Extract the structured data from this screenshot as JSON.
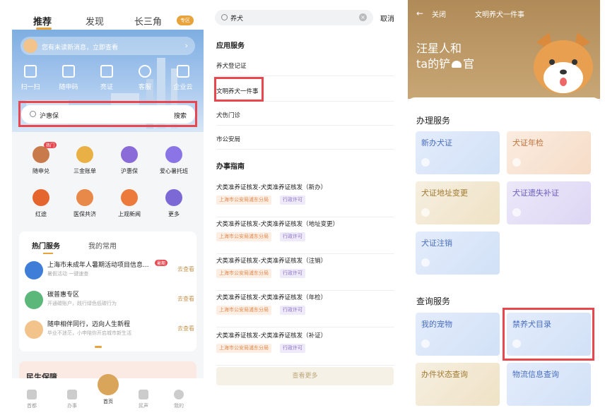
{
  "p1": {
    "tabs": [
      "推荐",
      "发现",
      "长三角"
    ],
    "region": "专区",
    "message": "您有未读新消息，立即查看",
    "quick": [
      "扫一扫",
      "随申码",
      "亮证",
      "客服",
      "企业云"
    ],
    "search": "沪惠保",
    "search_btn": "搜索",
    "svc_row1": [
      "随申兑",
      "三金账单",
      "沪惠保",
      "爱心暑托班"
    ],
    "svc_row2": [
      "红途",
      "医保共济",
      "上观新闻",
      "更多"
    ],
    "badge": "热门",
    "hot_tabs": [
      "热门服务",
      "我的常用"
    ],
    "hot": [
      {
        "title": "上海市未成年人暑期活动项目信息...",
        "sub": "暑假活动 一键速查",
        "go": "去查看",
        "tag": "暑期"
      },
      {
        "title": "碳普惠专区",
        "sub": "开通碳账户，践行绿色低碳行为",
        "go": "去查看"
      },
      {
        "title": "随申相伴同行，迈向人生新程",
        "sub": "毕业不迷茫，小申陪你开启城市新生活",
        "go": "去查看"
      }
    ],
    "banner": "民生保障",
    "nav": [
      "首都",
      "办事",
      "首页",
      "民声",
      "我的"
    ]
  },
  "p2": {
    "search": "养犬",
    "cancel": "取消",
    "sec1": "应用服务",
    "apps": [
      "养犬登记证",
      "文明养犬一件事",
      "犬伤门诊",
      "市公安局"
    ],
    "sec2": "办事指南",
    "guides": [
      {
        "title": "犬类准养证核发-犬类准养证核发（新办）",
        "org": "上海市公安局浦东分局",
        "type": "行政许可"
      },
      {
        "title": "犬类准养证核发-犬类准养证核发（地址变更）",
        "org": "上海市公安局浦东分局",
        "type": "行政许可"
      },
      {
        "title": "犬类准养证核发-犬类准养证核发（注销）",
        "org": "上海市公安局浦东分局",
        "type": "行政许可"
      },
      {
        "title": "犬类准养证核发-犬类准养证核发（年检）",
        "org": "上海市公安局浦东分局",
        "type": "行政许可"
      },
      {
        "title": "犬类准养证核发-犬类准养证核发（补证）",
        "org": "上海市公安局浦东分局",
        "type": "行政许可"
      }
    ],
    "more": "查看更多"
  },
  "p3": {
    "close": "关闭",
    "title": "文明养犬一件事",
    "hero1": "汪星人和",
    "hero2": "ta的铲",
    "hero3": "官",
    "sec1": "办理服务",
    "tiles1": [
      "新办犬证",
      "犬证年检",
      "犬证地址变更",
      "犬证遗失补证",
      "犬证注销"
    ],
    "sec2": "查询服务",
    "tiles2": [
      "我的宠物",
      "禁养犬目录",
      "办件状态查询",
      "物流信息查询"
    ]
  },
  "colors": {
    "accent": "#e8a33a",
    "highlight": "#e8474f",
    "gold": "#c49552"
  }
}
